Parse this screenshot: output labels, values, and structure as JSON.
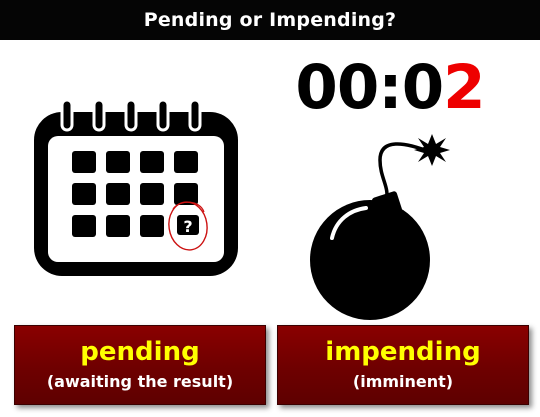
{
  "header": {
    "title": "Pending or Impending?"
  },
  "timer": {
    "prefix": "00:0",
    "last_digit": "2"
  },
  "calendar": {
    "marker_glyph": "?"
  },
  "options": [
    {
      "word": "pending",
      "gloss": "(awaiting the result)"
    },
    {
      "word": "impending",
      "gloss": "(imminent)"
    }
  ],
  "colors": {
    "title_bar": "#050505",
    "button_fill": "#7a0000",
    "word_text": "#ffff00",
    "gloss_text": "#ffffff",
    "timer_accent": "#ee0000"
  },
  "icons": {
    "calendar": "calendar-icon",
    "bomb": "bomb-icon"
  }
}
